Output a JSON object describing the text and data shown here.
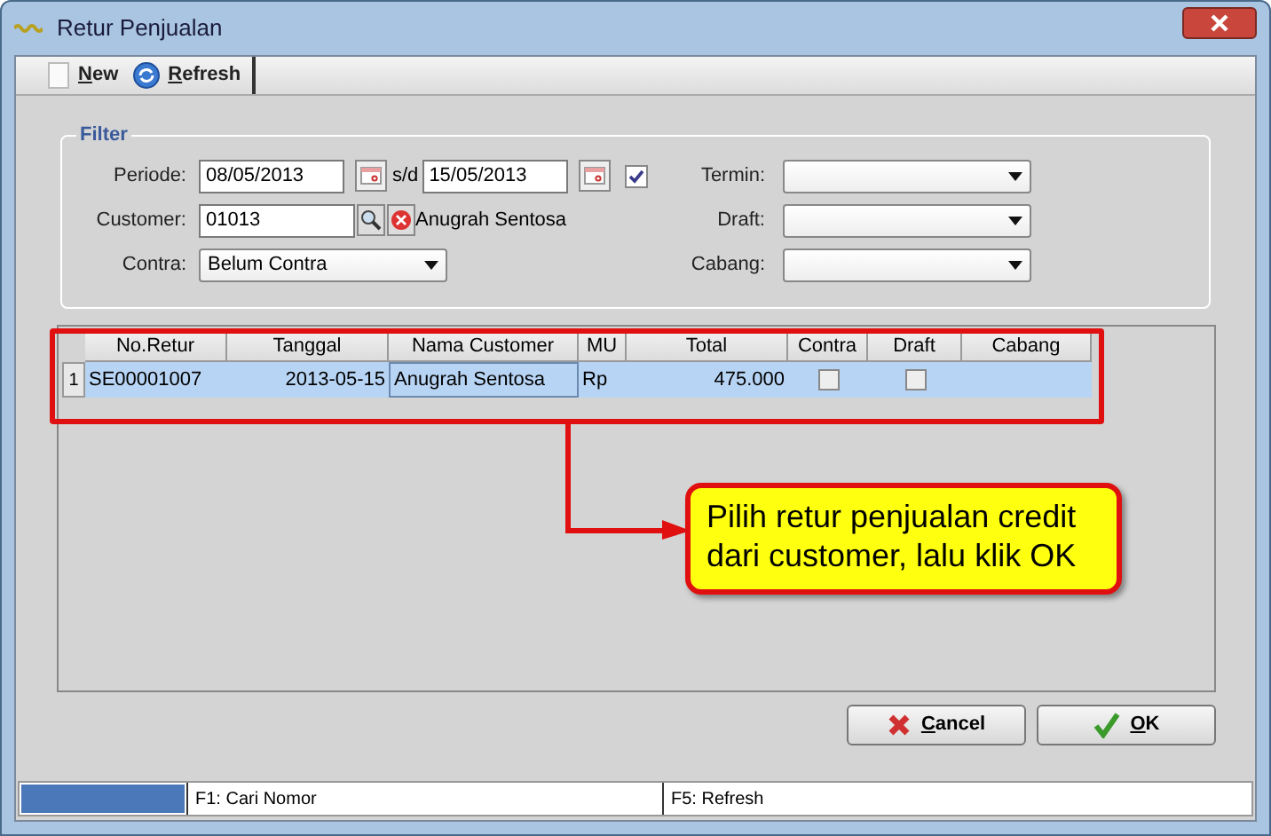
{
  "window": {
    "title": "Retur Penjualan"
  },
  "toolbar": [
    {
      "kind": "new",
      "label": "New"
    },
    {
      "kind": "refresh",
      "label": "Refresh"
    }
  ],
  "filter": {
    "title": "Filter",
    "periode": {
      "label": "Periode:",
      "from": "08/05/2013",
      "separator": "s/d",
      "to": "15/05/2013",
      "checked": true
    },
    "customer": {
      "label": "Customer:",
      "code": "01013",
      "name": "Anugrah Sentosa"
    },
    "contra": {
      "label": "Contra:",
      "value": "Belum Contra"
    },
    "termin": {
      "label": "Termin:"
    },
    "draft": {
      "label": "Draft:"
    },
    "cabang": {
      "label": "Cabang:"
    }
  },
  "table": {
    "columns": [
      "No.Retur",
      "Tanggal",
      "Nama Customer",
      "MU",
      "Total",
      "Contra",
      "Draft",
      "Cabang"
    ],
    "rows": [
      {
        "number": "1",
        "no_retur": "SE00001007",
        "tanggal": "2013-05-15",
        "nama_customer": "Anugrah Sentosa",
        "mu": "Rp",
        "total": "475.000",
        "contra": false,
        "draft": false,
        "selected": true
      }
    ]
  },
  "callout": {
    "text": "Pilih retur penjualan credit dari customer, lalu klik OK"
  },
  "buttons": [
    {
      "kind": "cancel",
      "label": "Cancel"
    },
    {
      "kind": "ok",
      "label": "OK"
    }
  ],
  "status_bar": [
    "F1: Cari Nomor",
    "F5: Refresh"
  ]
}
